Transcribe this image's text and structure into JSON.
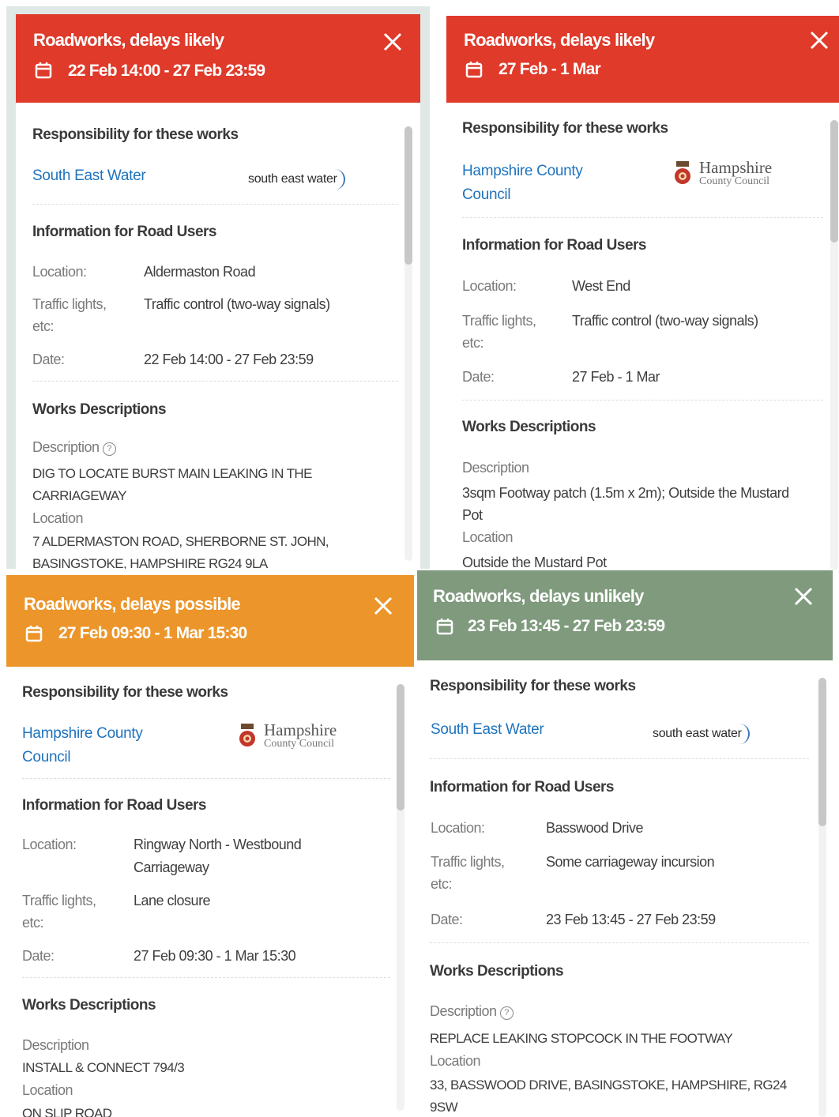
{
  "colors": {
    "likely": "#e03a2a",
    "possible": "#ec952a",
    "unlikely": "#7f9a7d",
    "link": "#1e73be"
  },
  "common": {
    "responsibility_heading": "Responsibility for these works",
    "road_users_heading": "Information for Road Users",
    "works_heading": "Works Descriptions",
    "location_label": "Location:",
    "traffic_label": "Traffic lights, etc:",
    "date_label": "Date:",
    "description_label": "Description",
    "location_sub_label": "Location"
  },
  "icons": {
    "calendar": "calendar-icon",
    "close": "close-icon",
    "help": "help-icon"
  },
  "cards": [
    {
      "severity": "Roadworks, delays likely",
      "date_range": "22 Feb 14:00 - 27 Feb 23:59",
      "org": "South East Water",
      "logo_text": "south east water",
      "location": "Aldermaston Road",
      "traffic": "Traffic control (two-way signals)",
      "date": "22 Feb 14:00 - 27 Feb 23:59",
      "description": "DIG TO LOCATE BURST MAIN LEAKING IN THE CARRIAGEWAY",
      "works_location": "7 ALDERMASTON ROAD, SHERBORNE ST. JOHN, BASINGSTOKE, HAMPSHIRE RG24 9LA"
    },
    {
      "severity": "Roadworks, delays likely",
      "date_range": "27 Feb - 1 Mar",
      "org": "Hampshire County Council",
      "logo_line1": "Hampshire",
      "logo_line2": "County Council",
      "location": "West End",
      "traffic": "Traffic control (two-way signals)",
      "date": "27 Feb - 1 Mar",
      "description": "3sqm Footway patch (1.5m x 2m); Outside the Mustard Pot",
      "works_location": "Outside the Mustard Pot"
    },
    {
      "severity": "Roadworks, delays possible",
      "date_range": "27 Feb 09:30 - 1 Mar 15:30",
      "org": "Hampshire County Council",
      "logo_line1": "Hampshire",
      "logo_line2": "County Council",
      "location": "Ringway North - Westbound Carriageway",
      "traffic": "Lane closure",
      "date": "27 Feb 09:30 - 1 Mar 15:30",
      "description": "INSTALL & CONNECT 794/3",
      "works_location": "ON SLIP ROAD"
    },
    {
      "severity": "Roadworks, delays unlikely",
      "date_range": "23 Feb 13:45 - 27 Feb 23:59",
      "org": "South East Water",
      "logo_text": "south east water",
      "location": "Basswood Drive",
      "traffic": "Some carriageway incursion",
      "date": "23 Feb 13:45 - 27 Feb 23:59",
      "description": "REPLACE LEAKING STOPCOCK IN THE FOOTWAY",
      "works_location": "33, BASSWOOD DRIVE, BASINGSTOKE, HAMPSHIRE, RG24 9SW"
    }
  ]
}
